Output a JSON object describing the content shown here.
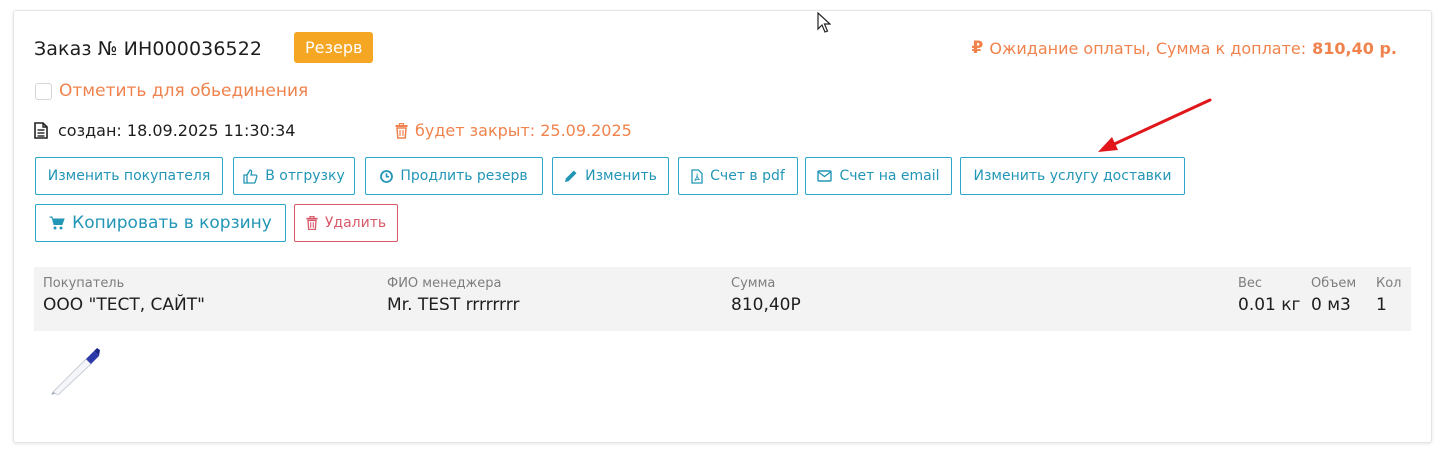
{
  "order": {
    "title": "Заказ № ИН000036522",
    "badge": "Резерв",
    "payment_status_text": "Ожидание оплаты, Сумма к доплате:",
    "payment_amount": "810,40 р.",
    "merge_label": "Отметить для обьединения",
    "merge_checked": false,
    "created": "создан: 18.09.2025 11:30:34",
    "closing": "будет закрыт: 25.09.2025"
  },
  "buttons": {
    "change_buyer": "Изменить покупателя",
    "to_shipment": "В отгрузку",
    "extend_reserve": "Продлить резерв",
    "edit": "Изменить",
    "invoice_pdf": "Счет в pdf",
    "invoice_email": "Счет на email",
    "change_delivery": "Изменить услугу доставки",
    "copy_to_cart": "Копировать в корзину",
    "delete": "Удалить"
  },
  "info": {
    "buyer_label": "Покупатель",
    "buyer_value": "ООО \"ТЕСТ, САЙТ\"",
    "manager_label": "ФИО менеджера",
    "manager_value": "Mr. TEST rrrrrrrr",
    "sum_label": "Сумма",
    "sum_value": "810,40Р",
    "weight_label": "Вес",
    "weight_value": "0.01 кг",
    "volume_label": "Объем",
    "volume_value": "0 м3",
    "qty_label": "Кол",
    "qty_value": "1"
  },
  "colors": {
    "accent_blue": "#2aa7c9",
    "accent_orange": "#f0834d",
    "badge_orange": "#f5a623",
    "danger_red": "#d85a6a",
    "annotation_arrow": "#e0161b"
  },
  "icons": [
    "ruble-icon",
    "document-icon",
    "trash-icon",
    "thumbs-up-icon",
    "clock-icon",
    "pencil-icon",
    "pdf-file-icon",
    "envelope-icon",
    "cart-icon",
    "pen-product-image",
    "mouse-cursor-icon",
    "annotation-arrow"
  ]
}
